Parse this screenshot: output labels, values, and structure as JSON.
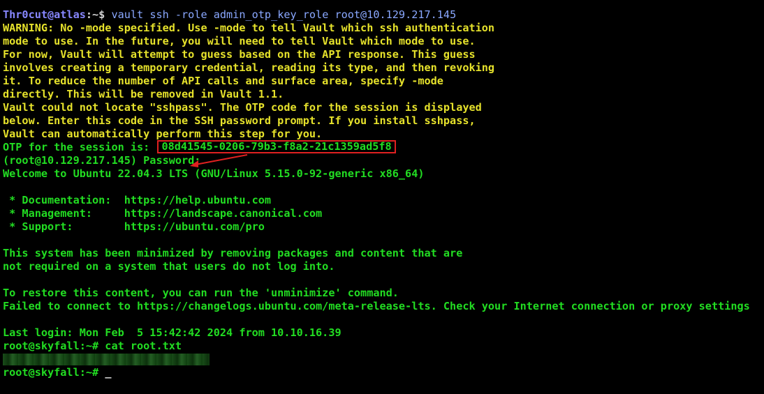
{
  "terminal": {
    "prompt_local": {
      "user_host": "Thr0cut@atlas",
      "path": ":~$",
      "command": " vault ssh -role admin_otp_key_role root@10.129.217.145"
    },
    "warning_lines": [
      "WARNING: No -mode specified. Use -mode to tell Vault which ssh authentication",
      "mode to use. In the future, you will need to tell Vault which mode to use.",
      "For now, Vault will attempt to guess based on the API response. This guess",
      "involves creating a temporary credential, reading its type, and then revoking",
      "it. To reduce the number of API calls and surface area, specify -mode",
      "directly. This will be removed in Vault 1.1.",
      "Vault could not locate \"sshpass\". The OTP code for the session is displayed",
      "below. Enter this code in the SSH password prompt. If you install sshpass,",
      "Vault can automatically perform this step for you."
    ],
    "otp_label": "OTP for the session is:",
    "otp_code": "08d41545-0206-79b3-f8a2-21c1359ad5f8",
    "password_prompt": "(root@10.129.217.145) Password:",
    "welcome": "Welcome to Ubuntu 22.04.3 LTS (GNU/Linux 5.15.0-92-generic x86_64)",
    "links": [
      " * Documentation:  https://help.ubuntu.com",
      " * Management:     https://landscape.canonical.com",
      " * Support:        https://ubuntu.com/pro"
    ],
    "minimized": [
      "This system has been minimized by removing packages and content that are",
      "not required on a system that users do not log into."
    ],
    "restore": [
      "To restore this content, you can run the 'unminimize' command.",
      "Failed to connect to https://changelogs.ubuntu.com/meta-release-lts. Check your Internet connection or proxy settings"
    ],
    "last_login": "Last login: Mon Feb  5 15:42:42 2024 from 10.10.16.39",
    "root_prompt_1": "root@skyfall:~# cat root.txt",
    "root_prompt_2": "root@skyfall:~# ",
    "cursor": "_"
  },
  "colors": {
    "warning": "#e6e22b",
    "output": "#22dd22",
    "highlight_box": "#e02020",
    "background": "#000000"
  }
}
